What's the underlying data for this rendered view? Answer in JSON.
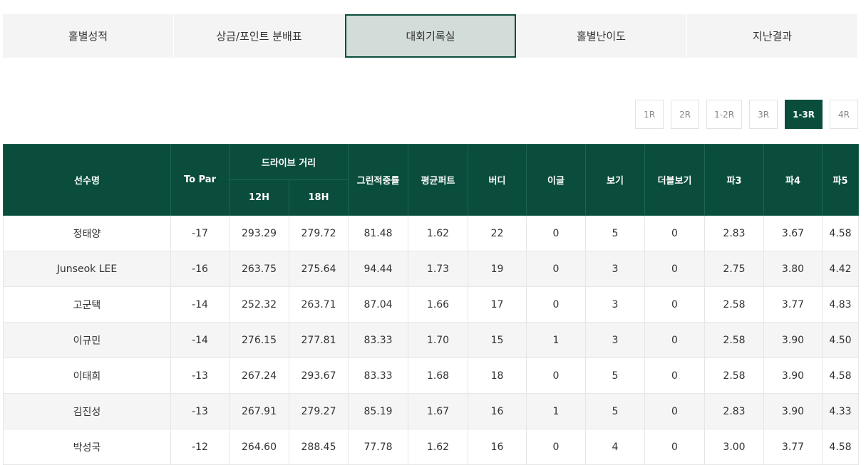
{
  "tabs": [
    {
      "label": "홀별성적"
    },
    {
      "label": "상금/포인트 분배표"
    },
    {
      "label": "대회기록실"
    },
    {
      "label": "홀별난이도"
    },
    {
      "label": "지난결과"
    }
  ],
  "active_tab": "대회기록실",
  "rounds": [
    {
      "label": "1R"
    },
    {
      "label": "2R"
    },
    {
      "label": "1-2R"
    },
    {
      "label": "3R"
    },
    {
      "label": "1-3R"
    },
    {
      "label": "4R"
    }
  ],
  "active_round": "1-3R",
  "colors": {
    "header_bg": "#0a4d3c",
    "active_tab_bg": "#d2dcd8",
    "row_alt_bg": "#f5f5f5"
  },
  "table": {
    "headers": {
      "player": "선수명",
      "to_par": "To Par",
      "drive_group": "드라이브 거리",
      "drive_12h": "12H",
      "drive_18h": "18H",
      "gir": "그린적중률",
      "avg_putt": "평균퍼트",
      "birdie": "버디",
      "eagle": "이글",
      "bogey": "보기",
      "double_bogey": "더블보기",
      "par3": "파3",
      "par4": "파4",
      "par5": "파5"
    },
    "rows": [
      [
        "정태양",
        "-17",
        "293.29",
        "279.72",
        "81.48",
        "1.62",
        "22",
        "0",
        "5",
        "0",
        "2.83",
        "3.67",
        "4.58"
      ],
      [
        "Junseok LEE",
        "-16",
        "263.75",
        "275.64",
        "94.44",
        "1.73",
        "19",
        "0",
        "3",
        "0",
        "2.75",
        "3.80",
        "4.42"
      ],
      [
        "고군택",
        "-14",
        "252.32",
        "263.71",
        "87.04",
        "1.66",
        "17",
        "0",
        "3",
        "0",
        "2.58",
        "3.77",
        "4.83"
      ],
      [
        "이규민",
        "-14",
        "276.15",
        "277.81",
        "83.33",
        "1.70",
        "15",
        "1",
        "3",
        "0",
        "2.58",
        "3.90",
        "4.50"
      ],
      [
        "이태희",
        "-13",
        "267.24",
        "293.67",
        "83.33",
        "1.68",
        "18",
        "0",
        "5",
        "0",
        "2.58",
        "3.90",
        "4.58"
      ],
      [
        "김진성",
        "-13",
        "267.91",
        "279.27",
        "85.19",
        "1.67",
        "16",
        "1",
        "5",
        "0",
        "2.83",
        "3.90",
        "4.33"
      ],
      [
        "박성국",
        "-12",
        "264.60",
        "288.45",
        "77.78",
        "1.62",
        "16",
        "0",
        "4",
        "0",
        "3.00",
        "3.77",
        "4.58"
      ]
    ]
  }
}
